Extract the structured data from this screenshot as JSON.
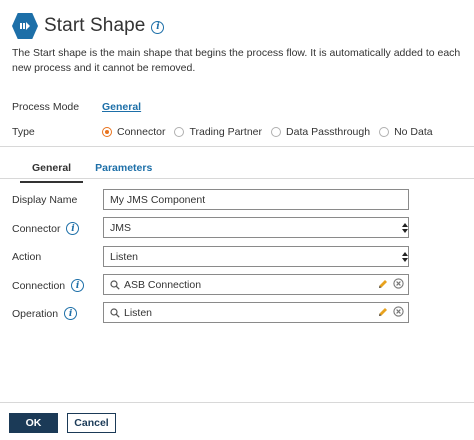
{
  "header": {
    "title": "Start Shape",
    "shape_icon": "start-shape-icon",
    "info_icon": "info-icon"
  },
  "description": "The Start shape is the main shape that begins the process flow. It is automatically added to each new process and it cannot be removed.",
  "process_mode": {
    "label": "Process Mode",
    "value": "General"
  },
  "type": {
    "label": "Type",
    "options": [
      "Connector",
      "Trading Partner",
      "Data Passthrough",
      "No Data"
    ],
    "selected": "Connector"
  },
  "tabs": [
    {
      "label": "General",
      "active": true
    },
    {
      "label": "Parameters",
      "active": false
    }
  ],
  "form": {
    "display_name": {
      "label": "Display Name",
      "value": "My JMS Component"
    },
    "connector": {
      "label": "Connector",
      "value": "JMS"
    },
    "action": {
      "label": "Action",
      "value": "Listen"
    },
    "connection": {
      "label": "Connection",
      "value": "ASB Connection"
    },
    "operation": {
      "label": "Operation",
      "value": "Listen"
    }
  },
  "footer": {
    "ok_label": "OK",
    "cancel_label": "Cancel"
  },
  "colors": {
    "accent": "#1d6fa8",
    "radio_selected": "#e8731e",
    "button_primary": "#1b3a57"
  }
}
